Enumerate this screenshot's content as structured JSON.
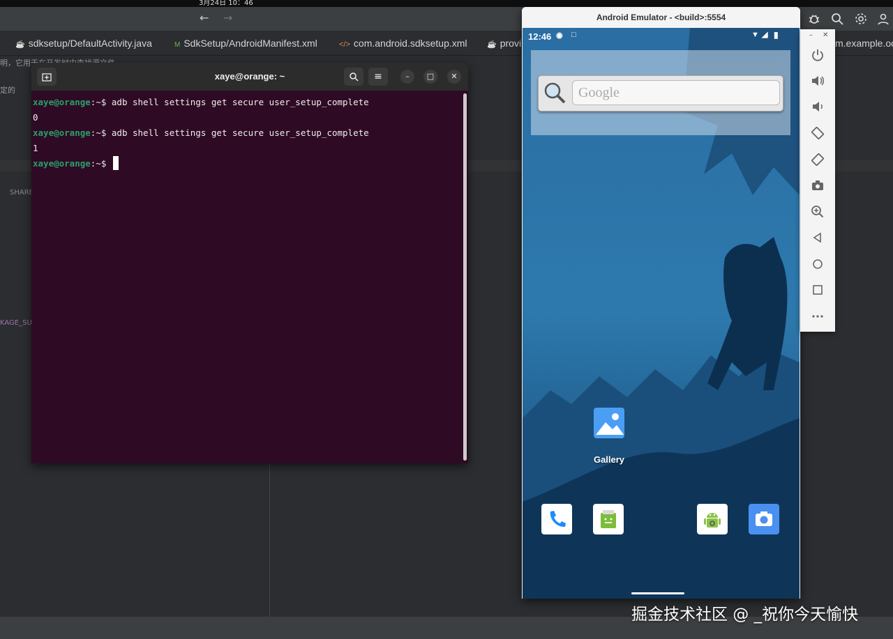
{
  "system": {
    "clock": "3月24日 10：46"
  },
  "ide": {
    "tabs": [
      {
        "label": "sdksetup/DefaultActivity.java",
        "icon": "java-class-icon"
      },
      {
        "label": "SdkSetup/AndroidManifest.xml",
        "icon": "manifest-icon"
      },
      {
        "label": "com.android.sdksetup.xml",
        "icon": "xml-icon"
      },
      {
        "label": "provi",
        "icon": "java-class-icon"
      },
      {
        "label": "m.example.oo",
        "icon": ""
      }
    ],
    "fragments": {
      "line1": "明，它用于在开发时中查找源文件",
      "line2": "定的",
      "line3": "SHARE",
      "line4": "KAGE_SU"
    }
  },
  "terminal": {
    "title": "xaye@orange: ~",
    "lines": [
      {
        "user": "xaye@orange",
        "path": ":~$ ",
        "command": "adb shell settings get secure user_setup_complete"
      },
      {
        "output": "0"
      },
      {
        "user": "xaye@orange",
        "path": ":~$ ",
        "command": "adb shell settings get secure user_setup_complete"
      },
      {
        "output": "1"
      },
      {
        "user": "xaye@orange",
        "path": ":~$ ",
        "command": ""
      }
    ]
  },
  "emulator": {
    "title": "Android Emulator - <build>:5554",
    "status_time": "12:46",
    "search_placeholder": "Google",
    "apps": {
      "gallery": "Gallery"
    },
    "dock": [
      "phone-icon",
      "store-icon",
      "android-icon",
      "camera-icon"
    ],
    "tools": [
      "power-icon",
      "volume-up-icon",
      "volume-down-icon",
      "rotate-left-icon",
      "rotate-right-icon",
      "screenshot-icon",
      "zoom-icon",
      "back-icon",
      "home-icon",
      "overview-icon",
      "more-icon"
    ],
    "accent": "#1d5a8a"
  },
  "watermark": "掘金技术社区 @ _祝你今天愉快"
}
